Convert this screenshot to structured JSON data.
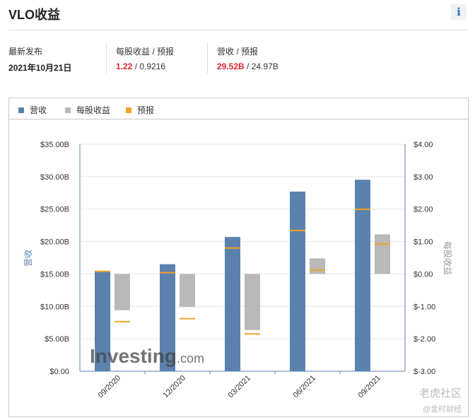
{
  "header": {
    "title": "VLO收益",
    "info_icon": "i"
  },
  "stats": {
    "latest": {
      "label": "最新发布",
      "value": "2021年10月21日"
    },
    "eps": {
      "label": "每股收益 / 预报",
      "actual": "1.22",
      "sep": " / ",
      "forecast": "0.9216"
    },
    "revenue": {
      "label": "营收 / 预报",
      "actual": "29.52B",
      "sep": " / ",
      "forecast": "24.97B"
    }
  },
  "legend": {
    "revenue": "营收",
    "eps": "每股收益",
    "forecast": "预报"
  },
  "colors": {
    "revenue": "#5b82af",
    "revenue_light": "#aec3dc",
    "eps": "#b9b9b9",
    "forecast": "#f0a326",
    "actual_highlight": "#e0232c"
  },
  "watermark": {
    "brand": "Investing",
    "brand_suffix": ".com",
    "site": "老虎社区",
    "site2": "@金时财经"
  },
  "chart_data": {
    "type": "bar",
    "categories": [
      "09/2020",
      "12/2020",
      "03/2021",
      "06/2021",
      "09/2021"
    ],
    "ylabel_left": "营收",
    "ylabel_right": "每股收益",
    "left_axis": {
      "min": 0,
      "max": 35,
      "ticks": [
        "$0.00",
        "$5.00B",
        "$10.00B",
        "$15.00B",
        "$20.00B",
        "$25.00B",
        "$30.00B",
        "$35.00B"
      ]
    },
    "right_axis": {
      "min": -3,
      "max": 4,
      "ticks": [
        "$-3.00",
        "$-2.00",
        "$-1.00",
        "$0.00",
        "$1.00",
        "$2.00",
        "$3.00",
        "$4.00"
      ]
    },
    "series": [
      {
        "name": "营收",
        "axis": "left",
        "values": [
          15.5,
          16.5,
          20.7,
          27.7,
          29.52
        ]
      },
      {
        "name": "营收预报",
        "axis": "left",
        "values": [
          15.4,
          15.2,
          19.0,
          21.7,
          24.97
        ]
      },
      {
        "name": "每股收益",
        "axis": "right",
        "values": [
          -1.12,
          -1.02,
          -1.73,
          0.48,
          1.22
        ]
      },
      {
        "name": "每股收益预报",
        "axis": "right",
        "values": [
          -1.47,
          -1.38,
          -1.85,
          0.12,
          0.92
        ]
      }
    ],
    "grid": true
  }
}
